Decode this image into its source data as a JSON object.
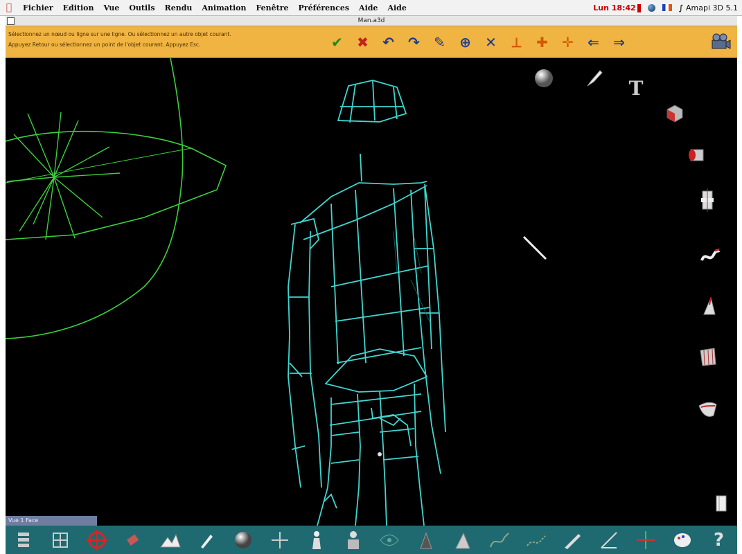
{
  "menubar": {
    "items": [
      "Fichier",
      "Edition",
      "Vue",
      "Outils",
      "Rendu",
      "Animation",
      "Fenêtre",
      "Préférences",
      "Aide",
      "Aide"
    ],
    "clock": "Lun 18:42",
    "app_name": "Amapi 3D 5.1"
  },
  "window": {
    "title": "Man.a3d"
  },
  "prompt": {
    "line1": "Sélectionnez un nœud ou ligne sur une ligne. Ou sélectionnez un autre objet courant.",
    "line2": "Appuyez Retour ou sélectionnez un point de l'objet courant. Appuyez Esc."
  },
  "toolbar": {
    "tools": [
      {
        "name": "validate-icon",
        "glyph": "✔",
        "color": "#1a8a1a"
      },
      {
        "name": "cancel-icon",
        "glyph": "✖",
        "color": "#c42020"
      },
      {
        "name": "undo-icon",
        "glyph": "↶",
        "color": "#1c3c8c"
      },
      {
        "name": "redo-icon",
        "glyph": "↷",
        "color": "#1c3c8c"
      },
      {
        "name": "pick-icon",
        "glyph": "✎",
        "color": "#1c3c8c"
      },
      {
        "name": "rotate-icon",
        "glyph": "⊕",
        "color": "#1c3c8c"
      },
      {
        "name": "scale-icon",
        "glyph": "✕",
        "color": "#1c3c8c"
      },
      {
        "name": "axis-icon",
        "glyph": "⟂",
        "color": "#d25a00"
      },
      {
        "name": "pivot-icon",
        "glyph": "✚",
        "color": "#d25a00"
      },
      {
        "name": "center-icon",
        "glyph": "✛",
        "color": "#d25a00"
      },
      {
        "name": "back-icon",
        "glyph": "⇐",
        "color": "#1c3c8c"
      },
      {
        "name": "forward-icon",
        "glyph": "⇒",
        "color": "#1c3c8c"
      }
    ]
  },
  "status": {
    "text": "Vue 1   Face"
  },
  "colors": {
    "toolbar_bg": "#f0b442",
    "viewport_bg": "#000000",
    "wireframe": "#3fd6d0",
    "light": "#3bd03b",
    "palette_bg": "#1f6a70"
  },
  "side_palette": [
    "sphere-icon",
    "pen-icon",
    "text-icon",
    "box-icon",
    "cylinder-icon",
    "lathe-icon",
    "curve-icon",
    "cone-icon",
    "surface-icon",
    "shell-icon",
    "book-icon"
  ],
  "bottom_palette": [
    "layers-icon",
    "grid-icon",
    "target-icon",
    "eraser-icon",
    "mountain-icon",
    "brush-icon",
    "sphere-icon",
    "move-icon",
    "person-icon",
    "figure-icon",
    "eye-icon",
    "cone-icon",
    "pyramid-icon",
    "spline-icon",
    "wave-icon",
    "wrench-icon",
    "triangle-icon",
    "crosshair-icon",
    "palette-icon",
    "help-icon"
  ]
}
